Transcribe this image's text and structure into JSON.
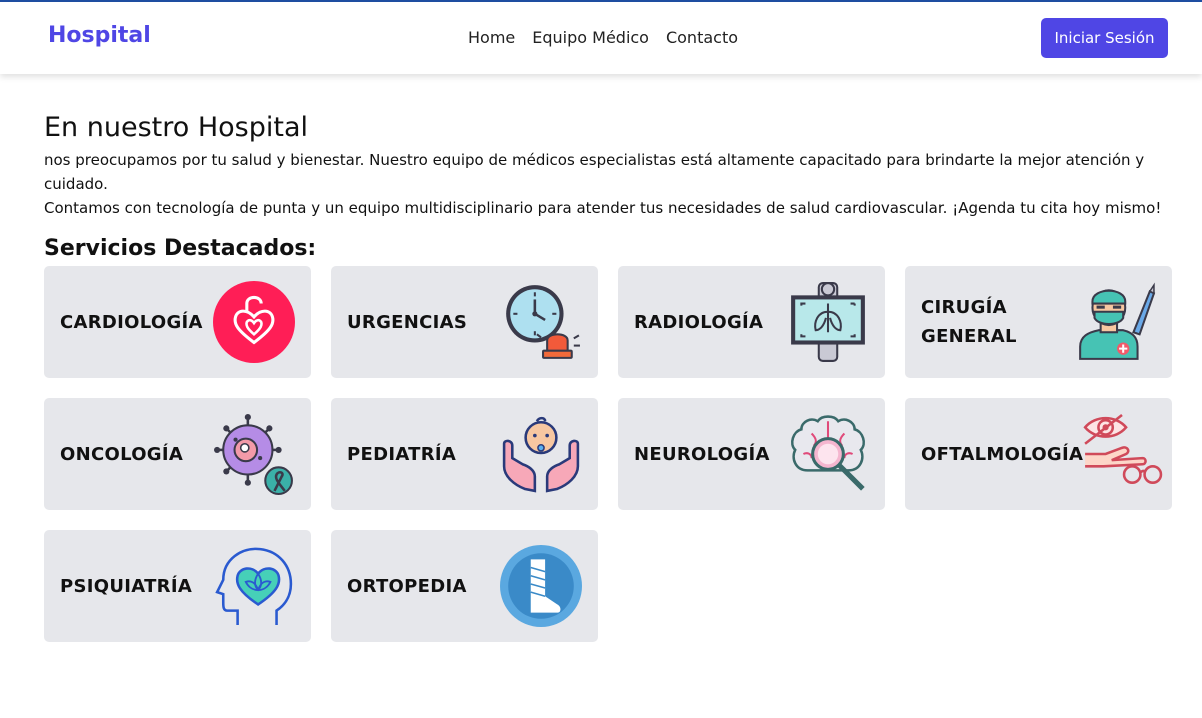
{
  "nav": {
    "brand": "Hospital",
    "links": [
      "Home",
      "Equipo Médico",
      "Contacto"
    ],
    "login_label": "Iniciar Sesión"
  },
  "hero": {
    "title": "En nuestro Hospital",
    "text_line1": "nos preocupamos por tu salud y bienestar. Nuestro equipo de médicos especialistas está altamente capacitado para brindarte la mejor atención y cuidado.",
    "text_line2": "Contamos con tecnología de punta y un equipo multidisciplinario para atender tus necesidades de salud cardiovascular. ¡Agenda tu cita hoy mismo!"
  },
  "services": {
    "title": "Servicios Destacados:",
    "items": [
      {
        "label": "CARDIOLOGÍA",
        "icon": "heart-lock-icon"
      },
      {
        "label": "URGENCIAS",
        "icon": "clock-alarm-icon"
      },
      {
        "label": "RADIOLOGÍA",
        "icon": "xray-icon"
      },
      {
        "label": "CIRUGÍA GENERAL",
        "icon": "surgeon-icon"
      },
      {
        "label": "ONCOLOGÍA",
        "icon": "cancer-cell-icon"
      },
      {
        "label": "PEDIATRÍA",
        "icon": "baby-hands-icon"
      },
      {
        "label": "NEUROLOGÍA",
        "icon": "brain-magnifier-icon"
      },
      {
        "label": "OFTALMOLOGÍA",
        "icon": "eye-glasses-icon"
      },
      {
        "label": "PSIQUIATRÍA",
        "icon": "head-heart-icon"
      },
      {
        "label": "ORTOPEDIA",
        "icon": "leg-cast-icon"
      }
    ]
  },
  "colors": {
    "brand": "#4f46e5",
    "card_bg": "#e6e7eb",
    "cardio_red": "#ff1e56",
    "ortho_blue": "#5aa8e0"
  }
}
